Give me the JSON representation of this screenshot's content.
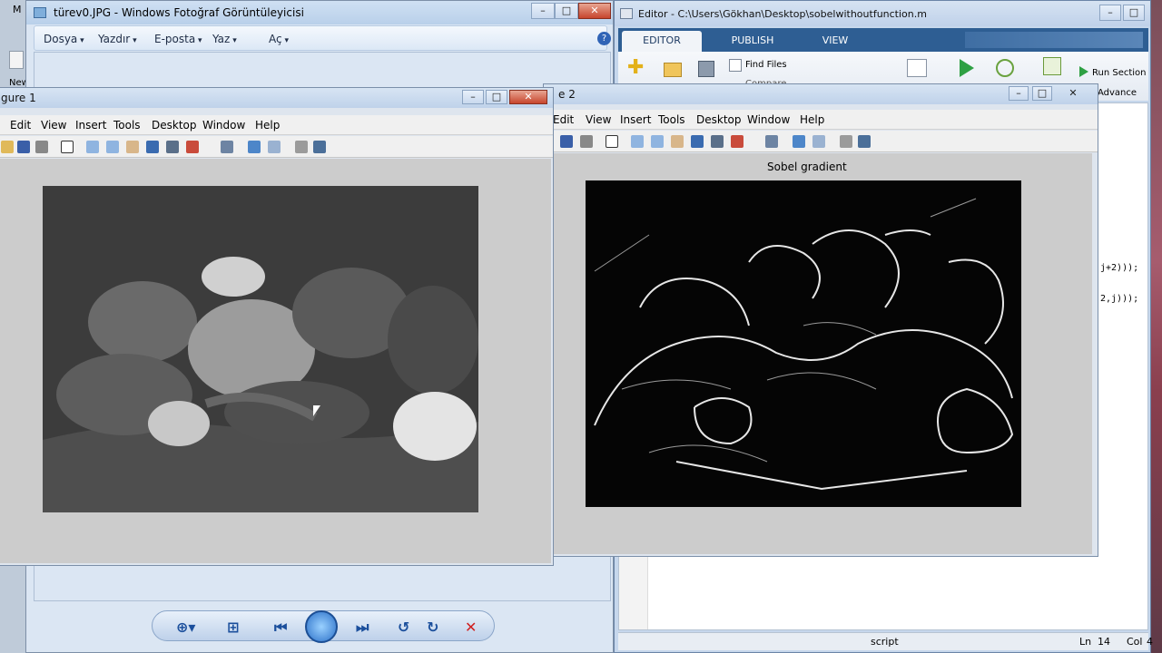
{
  "photo_viewer": {
    "title": "türev0.JPG - Windows Fotoğraf Görüntüleyicisi",
    "menu": [
      "Dosya",
      "Yazdır",
      "E-posta",
      "Yaz",
      "Aç"
    ],
    "help": "?"
  },
  "background_app": {
    "label_m": "M",
    "label_new": "New"
  },
  "editor": {
    "title": "Editor - C:\\Users\\Gökhan\\Desktop\\sobelwithoutfunction.m",
    "tabs": [
      "EDITOR",
      "PUBLISH",
      "VIEW"
    ],
    "find_files": "Find Files",
    "compare": "Compare",
    "run_section": "Run Section",
    "advance": "Advance",
    "code_frag_1": "j+2)));",
    "code_frag_2": "2,j)));",
    "status_script": "script",
    "status_ln_label": "Ln",
    "status_ln": "14",
    "status_col_label": "Col",
    "status_col": "4"
  },
  "figure1": {
    "title": "gure 1",
    "menu": [
      "Edit",
      "View",
      "Insert",
      "Tools",
      "Desktop",
      "Window",
      "Help"
    ]
  },
  "figure2": {
    "title": "e 2",
    "menu": [
      "Edit",
      "View",
      "Insert",
      "Tools",
      "Desktop",
      "Window",
      "Help"
    ],
    "axes_title": "Sobel gradient"
  }
}
